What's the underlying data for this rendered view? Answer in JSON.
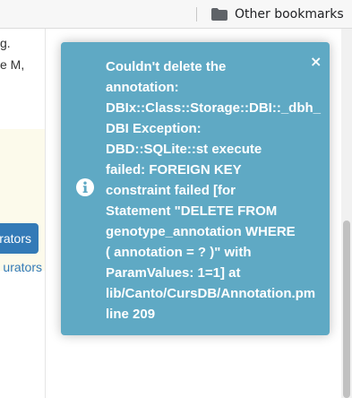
{
  "bookmarks_bar": {
    "other_bookmarks_label": "Other bookmarks",
    "folder_icon": "folder-icon"
  },
  "page": {
    "left_fragments": [
      "g.",
      "e M,"
    ],
    "curators_button_label": "urators",
    "curators_link_label": "urators"
  },
  "toast": {
    "close_symbol": "×",
    "info_icon": "info-icon",
    "background_color": "#5fa9c4",
    "message_lines": [
      "Couldn't delete the",
      "annotation:",
      "DBIx::Class::Storage::DBI::_dbh_",
      "DBI Exception:",
      "DBD::SQLite::st execute",
      "failed: FOREIGN KEY",
      "constraint failed [for",
      "Statement \"DELETE FROM",
      "genotype_annotation WHERE",
      "( annotation = ? )\" with",
      "ParamValues: 1=1] at",
      "lib/Canto/CursDB/Annotation.pm",
      "line 209"
    ]
  },
  "colors": {
    "link_blue": "#337ab7",
    "toast_bg": "#5fa9c4",
    "highlight_yellow": "#fcfaeb"
  }
}
